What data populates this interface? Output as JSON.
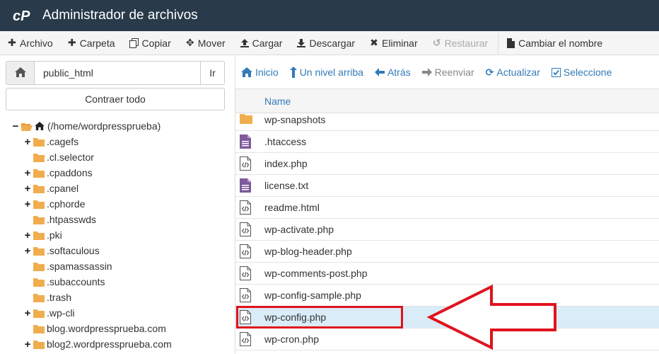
{
  "header": {
    "title": "Administrador de archivos",
    "logo_icon": "cpanel-logo-icon"
  },
  "toolbar": {
    "buttons": [
      {
        "label": "Archivo",
        "icon": "plus-icon"
      },
      {
        "label": "Carpeta",
        "icon": "plus-icon"
      },
      {
        "label": "Copiar",
        "icon": "copy-icon"
      },
      {
        "label": "Mover",
        "icon": "move-icon"
      },
      {
        "label": "Cargar",
        "icon": "upload-icon"
      },
      {
        "label": "Descargar",
        "icon": "download-icon"
      },
      {
        "label": "Eliminar",
        "icon": "close-icon"
      },
      {
        "label": "Restaurar",
        "icon": "undo-icon"
      },
      {
        "label": "Cambiar el nombre",
        "icon": "file-icon"
      }
    ]
  },
  "sidebar": {
    "path_value": "public_html",
    "go_label": "Ir",
    "collapse_label": "Contraer todo",
    "tree": [
      {
        "label": "(/home/wordpressprueba)",
        "toggle": "−",
        "open": true
      },
      {
        "label": ".cagefs",
        "toggle": "+"
      },
      {
        "label": ".cl.selector",
        "toggle": ""
      },
      {
        "label": ".cpaddons",
        "toggle": "+"
      },
      {
        "label": ".cpanel",
        "toggle": "+"
      },
      {
        "label": ".cphorde",
        "toggle": "+"
      },
      {
        "label": ".htpasswds",
        "toggle": ""
      },
      {
        "label": ".pki",
        "toggle": "+"
      },
      {
        "label": ".softaculous",
        "toggle": "+"
      },
      {
        "label": ".spamassassin",
        "toggle": ""
      },
      {
        "label": ".subaccounts",
        "toggle": ""
      },
      {
        "label": ".trash",
        "toggle": ""
      },
      {
        "label": ".wp-cli",
        "toggle": "+"
      },
      {
        "label": "blog.wordpressprueba.com",
        "toggle": ""
      },
      {
        "label": "blog2.wordpressprueba.com",
        "toggle": "+"
      }
    ]
  },
  "nav": {
    "inicio": "Inicio",
    "up": "Un nivel arriba",
    "back": "Atrás",
    "forward": "Reenviar",
    "refresh": "Actualizar",
    "select": "Seleccione"
  },
  "files": {
    "header_name": "Name",
    "rows": [
      {
        "name": "wp-snapshots",
        "type": "folder"
      },
      {
        "name": ".htaccess",
        "type": "text"
      },
      {
        "name": "index.php",
        "type": "code"
      },
      {
        "name": "license.txt",
        "type": "text"
      },
      {
        "name": "readme.html",
        "type": "code"
      },
      {
        "name": "wp-activate.php",
        "type": "code"
      },
      {
        "name": "wp-blog-header.php",
        "type": "code"
      },
      {
        "name": "wp-comments-post.php",
        "type": "code"
      },
      {
        "name": "wp-config-sample.php",
        "type": "code"
      },
      {
        "name": "wp-config.php",
        "type": "code",
        "selected": true
      },
      {
        "name": "wp-cron.php",
        "type": "code"
      }
    ]
  },
  "colors": {
    "header_bg": "#293a4a",
    "link": "#337ab7",
    "folder": "#f0ad4e",
    "annotation": "#e0131d",
    "selected_row": "#d9ecf8"
  }
}
